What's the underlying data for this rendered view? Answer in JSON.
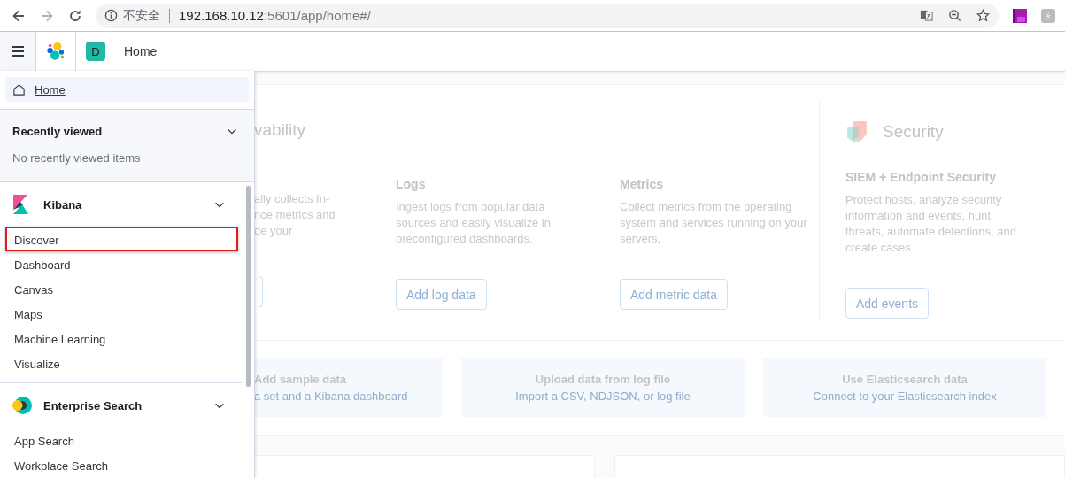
{
  "browser": {
    "nav_buttons": [
      {
        "kind": "back",
        "disabled": false
      },
      {
        "kind": "forward",
        "disabled": true
      },
      {
        "kind": "reload",
        "disabled": false
      }
    ],
    "security_label": "不安全",
    "url_host": "192.168.10.12",
    "url_rest": ":5601/app/home#/"
  },
  "header": {
    "space_initial": "D",
    "breadcrumb": "Home"
  },
  "nav": {
    "home_link": "Home",
    "recent": {
      "title": "Recently viewed",
      "expanded": true,
      "empty_text": "No recently viewed items"
    },
    "groups": [
      {
        "kind": "kibana",
        "title": "Kibana",
        "expanded": true,
        "items": [
          {
            "label": "Discover",
            "annotated": true
          },
          {
            "label": "Dashboard",
            "annotated": false
          },
          {
            "label": "Canvas",
            "annotated": false
          },
          {
            "label": "Maps",
            "annotated": false
          },
          {
            "label": "Machine Learning",
            "annotated": false
          },
          {
            "label": "Visualize",
            "annotated": false
          }
        ]
      },
      {
        "kind": "enterprise",
        "title": "Enterprise Search",
        "expanded": true,
        "items": [
          {
            "label": "App Search",
            "annotated": false
          },
          {
            "label": "Workplace Search",
            "annotated": false
          }
        ]
      }
    ]
  },
  "solutions": {
    "partial": {
      "title": "vability",
      "description_lines": [
        "ally collects In-",
        "nce metrics and",
        "de your"
      ]
    },
    "apps": [
      {
        "title": "Logs",
        "description": "Ingest logs from popular data sources and easily visualize in preconfigured dashboards.",
        "button": "Add log data"
      },
      {
        "title": "Metrics",
        "description": "Collect metrics from the operating system and services running on your servers.",
        "button": "Add metric data"
      }
    ],
    "security": {
      "title": "Security",
      "subtitle": "SIEM + Endpoint Security",
      "description": "Protect hosts, analyze security information and events, hunt threats, automate detections, and create cases.",
      "button": "Add events"
    }
  },
  "data_tiles": [
    {
      "title": "Add sample data",
      "subtitle": "a set and a Kibana dashboard"
    },
    {
      "title": "Upload data from log file",
      "subtitle": "Import a CSV, NDJSON, or log file"
    },
    {
      "title": "Use Elasticsearch data",
      "subtitle": "Connect to your Elasticsearch index"
    }
  ]
}
